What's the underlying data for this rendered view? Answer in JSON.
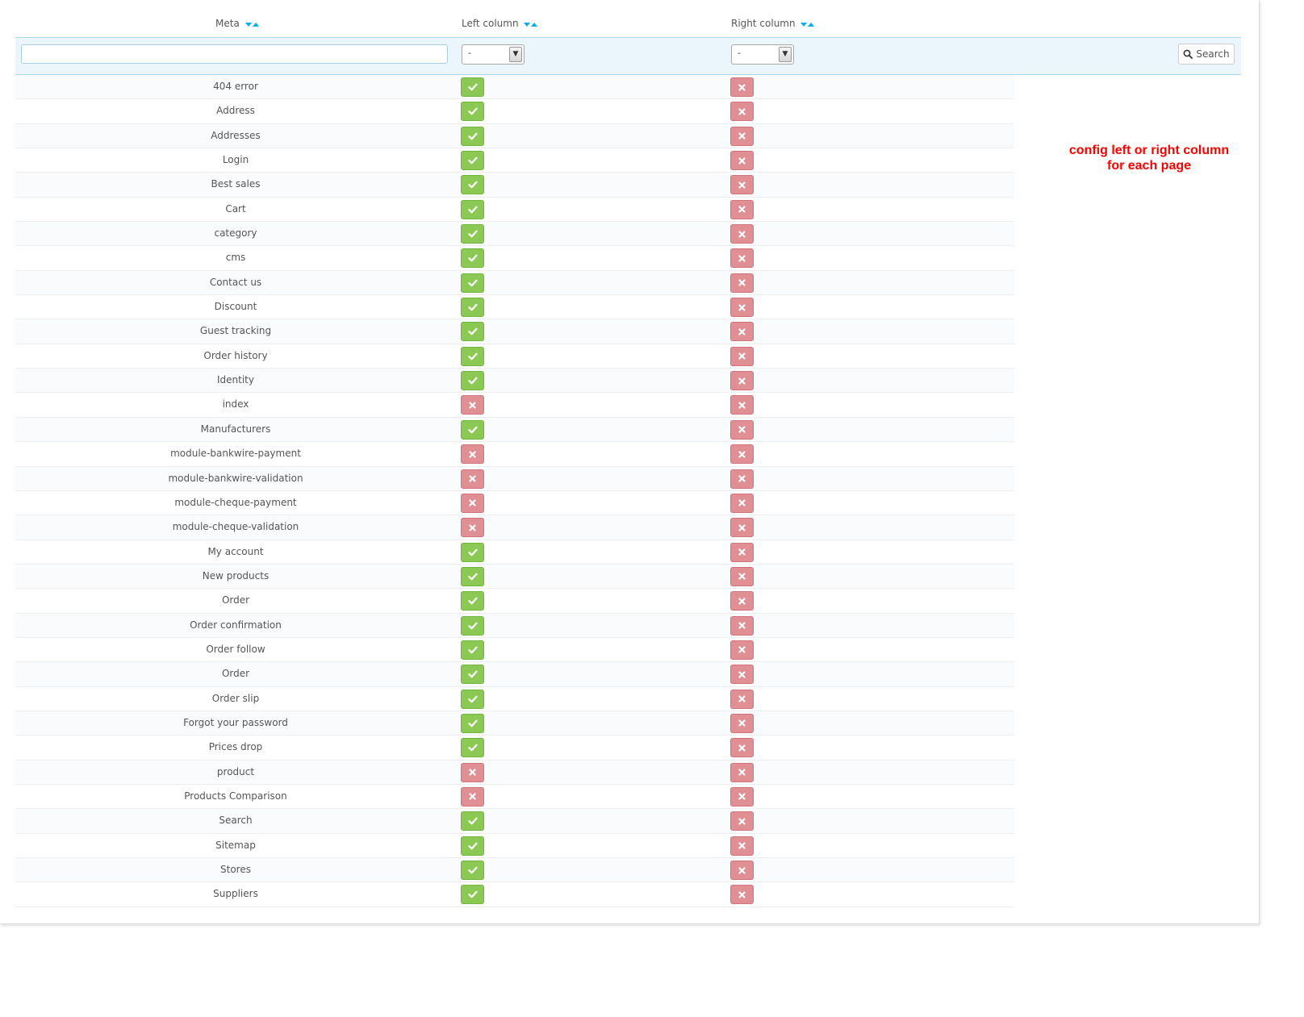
{
  "columns": {
    "meta": "Meta",
    "left": "Left column",
    "right": "Right column"
  },
  "filters": {
    "meta_value": "",
    "left_selected": "-",
    "right_selected": "-",
    "search_label": "Search"
  },
  "annotation": {
    "line1": "config left or right column",
    "line2": "for each page"
  },
  "colors": {
    "enabled": "#8bc954",
    "disabled": "#e08f95",
    "sort_arrow": "#00aff0",
    "annotation": "#ff0000"
  },
  "rows": [
    {
      "name": "404 error",
      "left": true,
      "right": false
    },
    {
      "name": "Address",
      "left": true,
      "right": false
    },
    {
      "name": "Addresses",
      "left": true,
      "right": false
    },
    {
      "name": "Login",
      "left": true,
      "right": false
    },
    {
      "name": "Best sales",
      "left": true,
      "right": false
    },
    {
      "name": "Cart",
      "left": true,
      "right": false
    },
    {
      "name": "category",
      "left": true,
      "right": false
    },
    {
      "name": "cms",
      "left": true,
      "right": false
    },
    {
      "name": "Contact us",
      "left": true,
      "right": false
    },
    {
      "name": "Discount",
      "left": true,
      "right": false
    },
    {
      "name": "Guest tracking",
      "left": true,
      "right": false
    },
    {
      "name": "Order history",
      "left": true,
      "right": false
    },
    {
      "name": "Identity",
      "left": true,
      "right": false
    },
    {
      "name": "index",
      "left": false,
      "right": false
    },
    {
      "name": "Manufacturers",
      "left": true,
      "right": false
    },
    {
      "name": "module-bankwire-payment",
      "left": false,
      "right": false
    },
    {
      "name": "module-bankwire-validation",
      "left": false,
      "right": false
    },
    {
      "name": "module-cheque-payment",
      "left": false,
      "right": false
    },
    {
      "name": "module-cheque-validation",
      "left": false,
      "right": false
    },
    {
      "name": "My account",
      "left": true,
      "right": false
    },
    {
      "name": "New products",
      "left": true,
      "right": false
    },
    {
      "name": "Order",
      "left": true,
      "right": false
    },
    {
      "name": "Order confirmation",
      "left": true,
      "right": false
    },
    {
      "name": "Order follow",
      "left": true,
      "right": false
    },
    {
      "name": "Order",
      "left": true,
      "right": false
    },
    {
      "name": "Order slip",
      "left": true,
      "right": false
    },
    {
      "name": "Forgot your password",
      "left": true,
      "right": false
    },
    {
      "name": "Prices drop",
      "left": true,
      "right": false
    },
    {
      "name": "product",
      "left": false,
      "right": false
    },
    {
      "name": "Products Comparison",
      "left": false,
      "right": false
    },
    {
      "name": "Search",
      "left": true,
      "right": false
    },
    {
      "name": "Sitemap",
      "left": true,
      "right": false
    },
    {
      "name": "Stores",
      "left": true,
      "right": false
    },
    {
      "name": "Suppliers",
      "left": true,
      "right": false
    }
  ]
}
